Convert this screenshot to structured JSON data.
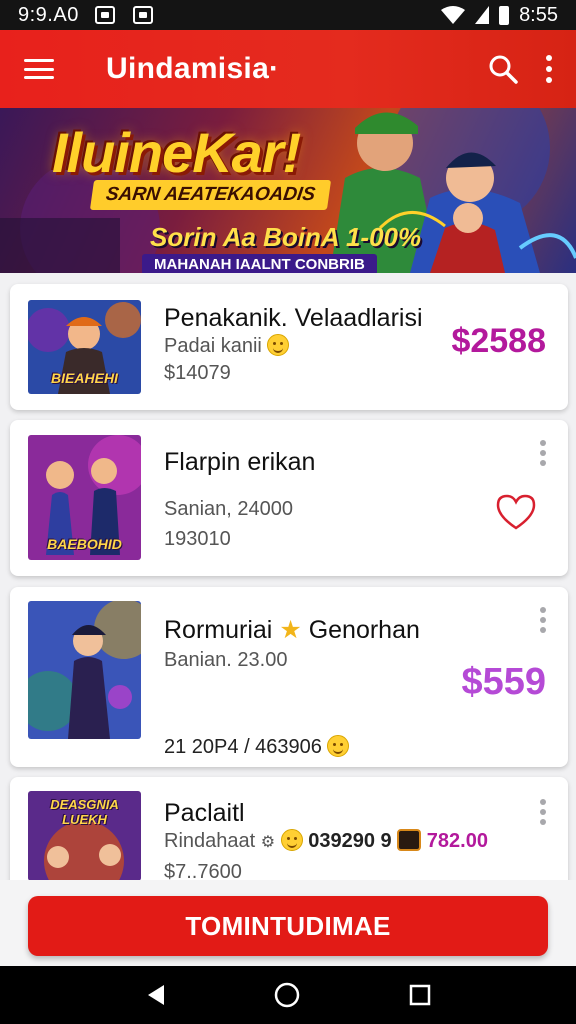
{
  "status_bar": {
    "time_left": "9:9.A0",
    "time_right": "8:55"
  },
  "app_bar": {
    "title": "Uindamisia·",
    "icons": [
      "menu-icon",
      "search-icon",
      "more-vert-icon"
    ]
  },
  "banner": {
    "title": "IluineKar!",
    "subtitle": "SARN AEATEKAOADIS",
    "promo": "Sorin Aa BoinA 1-00%",
    "strip": "MAHANAH IAALNT CONBRIB"
  },
  "items": [
    {
      "name": "Penakanik. Velaadlarisi",
      "line1": "Padai kanii",
      "line2": "$14079",
      "price": "$2588",
      "thumb_label": "BIEAHEHI"
    },
    {
      "name": "Flarpin erikan",
      "line1": "Sanian, 24000",
      "line2": "193010",
      "thumb_label": "BAEBOHID",
      "action_icon": "heart-outline-icon"
    },
    {
      "name": "Rormuriai",
      "name_suffix": "Genorhan",
      "line1": "Banian. 23.00",
      "line2": "21 20P4 / 463906",
      "price": "$559"
    },
    {
      "name": "Paclaitl",
      "line1": "Rindahaat",
      "line1_code": "039290 9",
      "line1_price": "782.00",
      "line2": "$7..7600",
      "thumb_label": "DEASGNIA LUEKH"
    }
  ],
  "cta": {
    "label": "TOMINTUDIMAE"
  },
  "colors": {
    "primary_red": "#e21b16",
    "price_magenta": "#b3199c",
    "price_violet": "#b54ad6"
  }
}
